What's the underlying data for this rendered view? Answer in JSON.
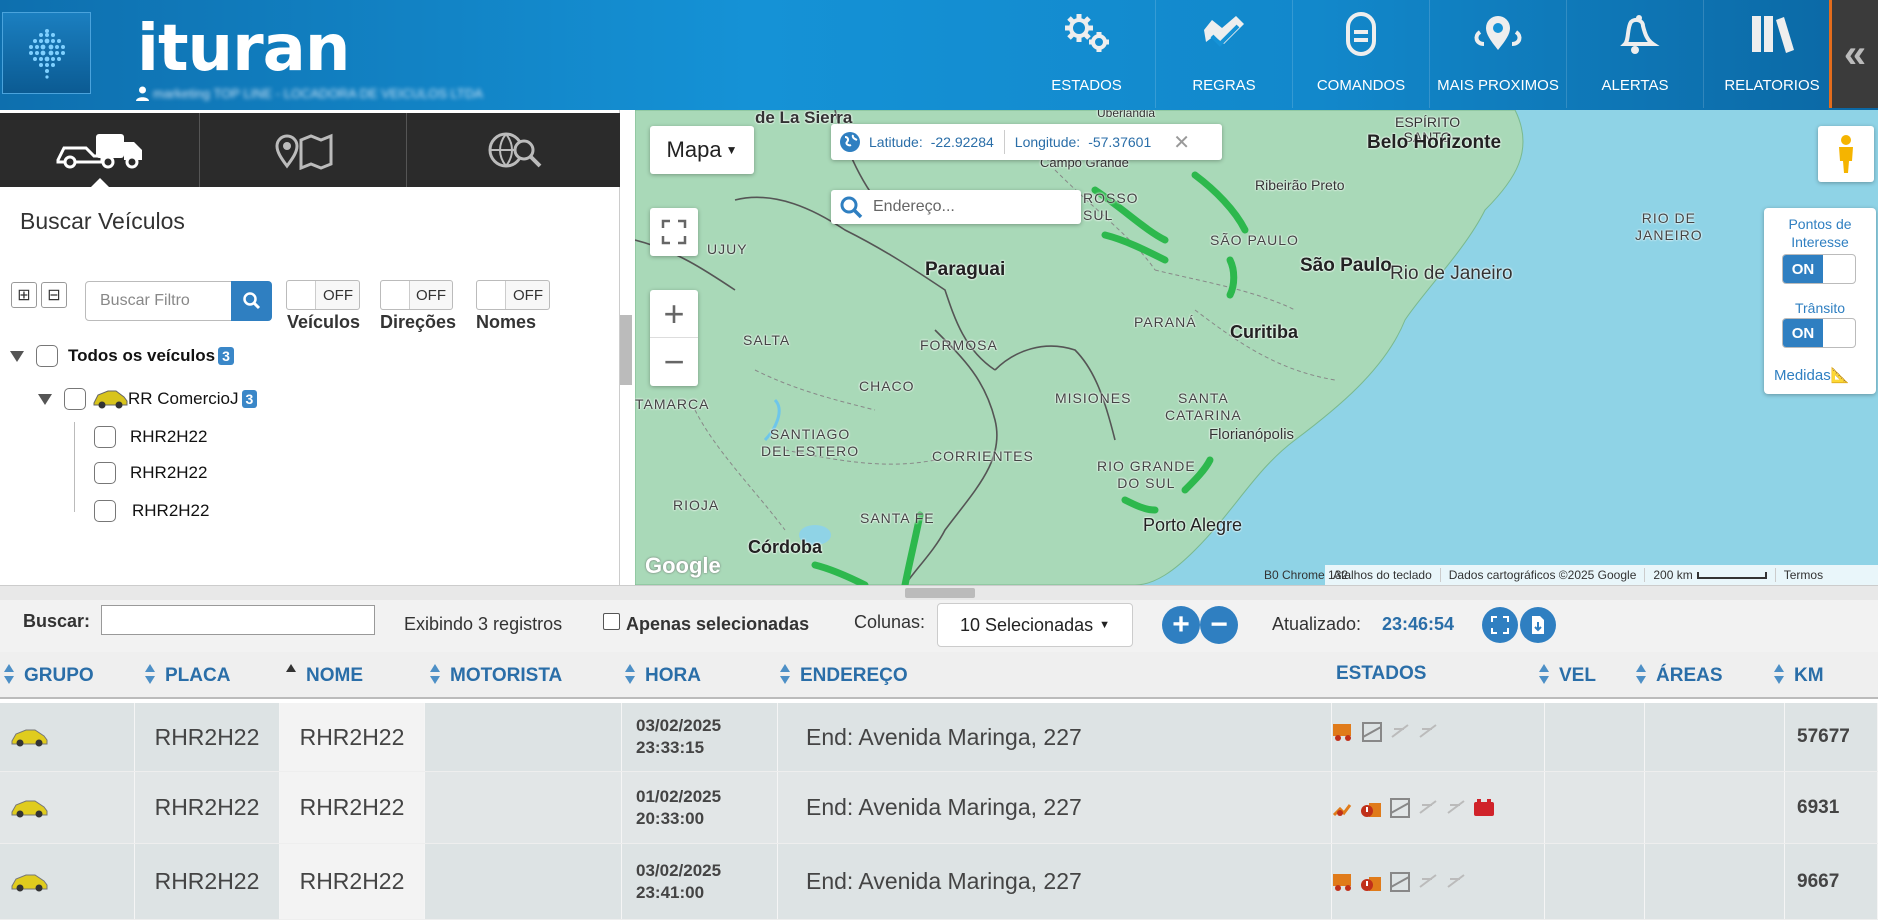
{
  "header": {
    "brand": "ituran",
    "user_text": "marketing TOP LINE - LOCADORA DE VEICULOS LTDA",
    "nav": [
      {
        "label": "ESTADOS",
        "icon": "gears-icon"
      },
      {
        "label": "REGRAS",
        "icon": "rules-icon"
      },
      {
        "label": "COMANDOS",
        "icon": "commands-icon"
      },
      {
        "label": "MAIS PROXIMOS",
        "icon": "nearby-icon"
      },
      {
        "label": "ALERTAS",
        "icon": "bell-icon"
      },
      {
        "label": "RELATORIOS",
        "icon": "books-icon"
      }
    ],
    "collapse_label": "«"
  },
  "left_panel": {
    "title": "Buscar Veículos",
    "filter_placeholder": "Buscar Filtro",
    "toggles": [
      {
        "state": "OFF",
        "label": "Veículos"
      },
      {
        "state": "OFF",
        "label": "Direções"
      },
      {
        "state": "OFF",
        "label": "Nomes"
      }
    ],
    "tree": {
      "root_label": "Todos os veículos",
      "root_count": "3",
      "group_label": "RR ComercioJ",
      "group_count": "3",
      "vehicles": [
        "RHR2H22",
        "RHR2H22",
        "RHR2H22"
      ]
    }
  },
  "map": {
    "type_label": "Mapa",
    "lat_label": "Latitude:",
    "lat_value": "-22.92284",
    "lon_label": "Longitude:",
    "lon_value": "-57.37601",
    "address_placeholder": "Endereço...",
    "poi_label": "Pontos de Interesse",
    "poi_state": "ON",
    "transit_label": "Trânsito",
    "transit_state": "ON",
    "measure_label": "Medidas",
    "labels": {
      "paraguai": "Paraguai",
      "belo_horizonte": "Belo Horizonte",
      "sao_paulo": "São Paulo",
      "rio": "Rio de Janeiro",
      "curitiba": "Curitiba",
      "florianopolis": "Florianópolis",
      "porto_alegre": "Porto Alegre",
      "cordoba": "Córdoba",
      "ribeirao": "Ribeirão Preto",
      "campo_grande": "Campo Grande",
      "de_la_sierra": "de La Sierra",
      "uberlandia": "Uberlândia",
      "espirito_santo": "ESPÍRITO\nSANTO",
      "rio_de_janeiro_state": "RIO DE\nJANEIRO",
      "mato_grosso": "ROSSO\nSUL",
      "sao_paulo_state": "SÃO PAULO",
      "parana": "PARANÁ",
      "santa_catarina": "SANTA\nCATARINA",
      "rio_grande": "RIO GRANDE\nDO SUL",
      "misiones": "MISIONES",
      "corrientes": "CORRIENTES",
      "santa_fe": "SANTA FE",
      "chaco": "CHACO",
      "formosa": "FORMOSA",
      "salta": "SALTA",
      "santiago": "SANTIAGO\nDEL ESTERO",
      "rioja": "RIOJA",
      "catamarca": "TAMARCA",
      "jujuy": "UJUY"
    },
    "google": "Google",
    "attribution": {
      "browser": "B0 Chrome 132",
      "shortcuts": "Atalhos do teclado",
      "data": "Dados cartográficos ©2025 Google",
      "scale": "200 km",
      "terms": "Termos"
    }
  },
  "toolbar": {
    "search_label": "Buscar:",
    "records": "Exibindo 3 registros",
    "only_selected": "Apenas selecionadas",
    "columns_label": "Colunas:",
    "columns_value": "10 Selecionadas",
    "updated_label": "Atualizado:",
    "updated_value": "23:46:54"
  },
  "grid": {
    "columns": [
      "GRUPO",
      "PLACA",
      "NOME",
      "MOTORISTA",
      "HORA",
      "ENDEREÇO",
      "ESTADOS",
      "VEL",
      "ÁREAS",
      "KM"
    ],
    "rows": [
      {
        "placa": "RHR2H22",
        "nome": "RHR2H22",
        "motorista": "",
        "date": "03/02/2025",
        "time": "23:33:15",
        "endereco": "End: Avenida Maringa, 227",
        "vel": "",
        "areas": "",
        "km": "57677"
      },
      {
        "placa": "RHR2H22",
        "nome": "RHR2H22",
        "motorista": "",
        "date": "01/02/2025",
        "time": "20:33:00",
        "endereco": "End: Avenida Maringa, 227",
        "vel": "",
        "areas": "",
        "km": "6931"
      },
      {
        "placa": "RHR2H22",
        "nome": "RHR2H22",
        "motorista": "",
        "date": "03/02/2025",
        "time": "23:41:00",
        "endereco": "End: Avenida Maringa, 227",
        "vel": "",
        "areas": "",
        "km": "9667"
      }
    ]
  },
  "colors": {
    "accent": "#2f7fc1",
    "header": "#1592d6",
    "transit": "#2db84d"
  }
}
